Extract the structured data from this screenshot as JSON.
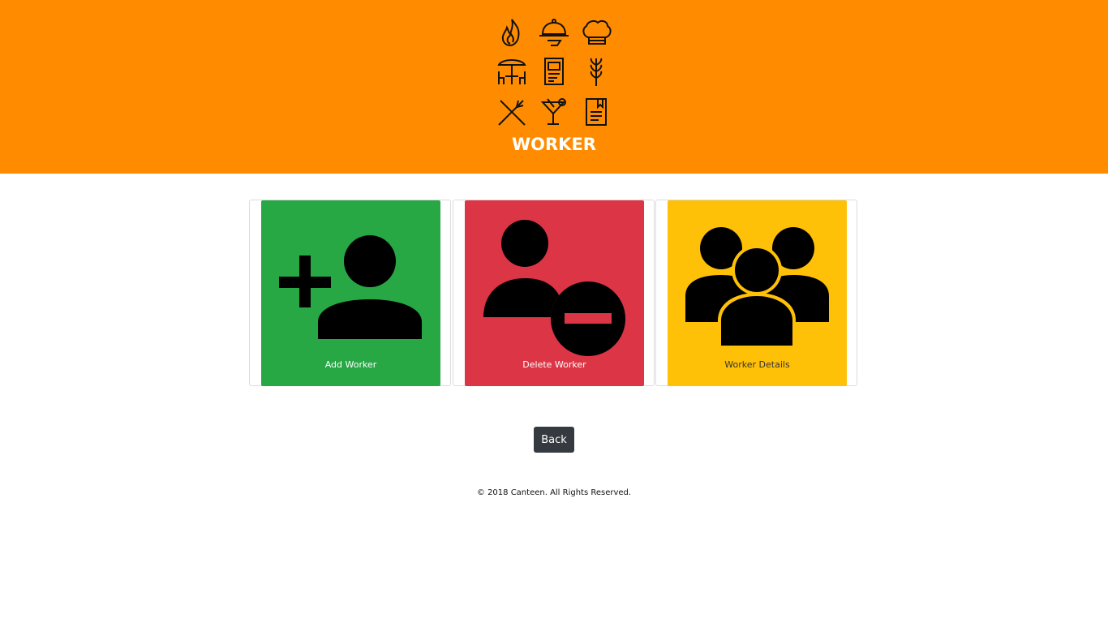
{
  "header": {
    "title": "WORKER",
    "background_color": "#ff8c00",
    "icons": [
      "flame-icon",
      "cloche-icon",
      "chef-hat-icon",
      "patio-umbrella-table-icon",
      "menu-icon",
      "wheat-icon",
      "fork-knife-icon",
      "cocktail-icon",
      "recipe-book-icon"
    ]
  },
  "cards": [
    {
      "label": "Add Worker",
      "color": "#28a745",
      "text_color": "#ffffff",
      "icon": "add-user-icon"
    },
    {
      "label": "Delete Worker",
      "color": "#dc3545",
      "text_color": "#ffffff",
      "icon": "remove-user-icon"
    },
    {
      "label": "Worker Details",
      "color": "#ffc107",
      "text_color": "#333333",
      "icon": "users-group-icon"
    }
  ],
  "back_button": {
    "label": "Back",
    "color": "#343a40"
  },
  "footer": {
    "text": "© 2018 Canteen. All Rights Reserved."
  }
}
